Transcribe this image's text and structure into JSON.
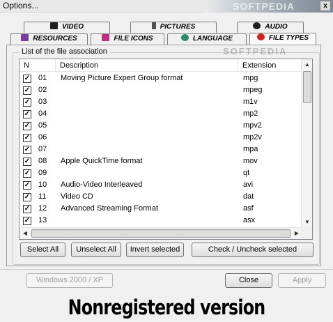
{
  "window": {
    "title": "Options...",
    "close_glyph": "x"
  },
  "watermark": "SOFTPEDIA",
  "tabs_row1": [
    {
      "label": "VIDEO",
      "icon": "video-icon",
      "color": "#202020"
    },
    {
      "label": "PICTURES",
      "icon": "pictures-icon",
      "color": "#505050"
    },
    {
      "label": "AUDIO",
      "icon": "audio-icon",
      "color": "#202020"
    }
  ],
  "tabs_row2": [
    {
      "label": "RESOURCES",
      "icon": "resources-icon",
      "color": "#7a3aa0"
    },
    {
      "label": "FILE ICONS",
      "icon": "file-icons-icon",
      "color": "#c03080"
    },
    {
      "label": "LANGUAGE",
      "icon": "language-icon",
      "color": "#2f8a6a"
    },
    {
      "label": "FILE TYPES",
      "icon": "file-types-icon",
      "color": "#d02020"
    }
  ],
  "group": {
    "label": "List of the file association"
  },
  "columns": {
    "n": "N",
    "description": "Description",
    "extension": "Extension"
  },
  "rows": [
    {
      "n": "01",
      "description": "Moving Picture Expert Group format",
      "ext": "mpg",
      "checked": true
    },
    {
      "n": "02",
      "description": "",
      "ext": "mpeg",
      "checked": true
    },
    {
      "n": "03",
      "description": "",
      "ext": "m1v",
      "checked": true
    },
    {
      "n": "04",
      "description": "",
      "ext": "mp2",
      "checked": true
    },
    {
      "n": "05",
      "description": "",
      "ext": "mpv2",
      "checked": true
    },
    {
      "n": "06",
      "description": "",
      "ext": "mp2v",
      "checked": true
    },
    {
      "n": "07",
      "description": "",
      "ext": "mpa",
      "checked": true
    },
    {
      "n": "08",
      "description": "Apple QuickTime format",
      "ext": "mov",
      "checked": true
    },
    {
      "n": "09",
      "description": "",
      "ext": "qt",
      "checked": true
    },
    {
      "n": "10",
      "description": "Audio-Video Interleaved",
      "ext": "avi",
      "checked": true
    },
    {
      "n": "11",
      "description": "Video CD",
      "ext": "dat",
      "checked": true
    },
    {
      "n": "12",
      "description": "Advanced Streaming Format",
      "ext": "asf",
      "checked": true
    },
    {
      "n": "13",
      "description": "",
      "ext": "asx",
      "checked": true
    }
  ],
  "list_buttons": {
    "select_all": "Select All",
    "unselect_all": "Unselect All",
    "invert": "Invert selected",
    "check_uncheck": "Check / Uncheck selected"
  },
  "footer": {
    "windows_xp": "Windows 2000 / XP",
    "close": "Close",
    "apply": "Apply",
    "nonregistered": "Nonregistered version"
  }
}
